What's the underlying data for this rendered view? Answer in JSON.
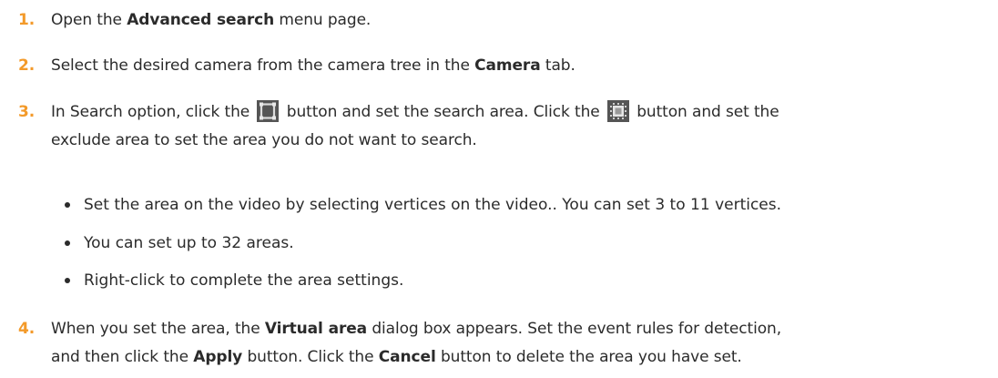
{
  "steps": [
    {
      "number": "1.",
      "parts": [
        "Open the ",
        "Advanced search",
        " menu page."
      ]
    },
    {
      "number": "2.",
      "parts": [
        "Select the desired camera from the camera tree in the ",
        "Camera",
        " tab."
      ]
    },
    {
      "number": "3.",
      "line1_a": "In Search option, click the ",
      "line1_b": " button and set the search area. Click the ",
      "line1_c": " button and set the",
      "line2": "exclude area to set the area you do not want to search.",
      "icons": [
        "search-area-icon",
        "exclude-area-icon"
      ]
    },
    {
      "number": "4.",
      "line1_a": "When you set the area, the ",
      "line1_b": "Virtual area",
      "line1_c": " dialog box appears. Set the event rules for detection,",
      "line2_a": "and then click the ",
      "line2_b": "Apply",
      "line2_c": " button. Click the ",
      "line2_d": "Cancel",
      "line2_e": " button to delete the area you have set."
    }
  ],
  "bullets": [
    "Set the area on the video by selecting vertices on the video.. You can set 3 to 11 vertices.",
    "You can set up to 32 areas.",
    "Right-click to complete the area settings."
  ],
  "colors": {
    "step_number": "#f39a2a",
    "text": "#2b2b2b",
    "icon_background": "#555555"
  }
}
